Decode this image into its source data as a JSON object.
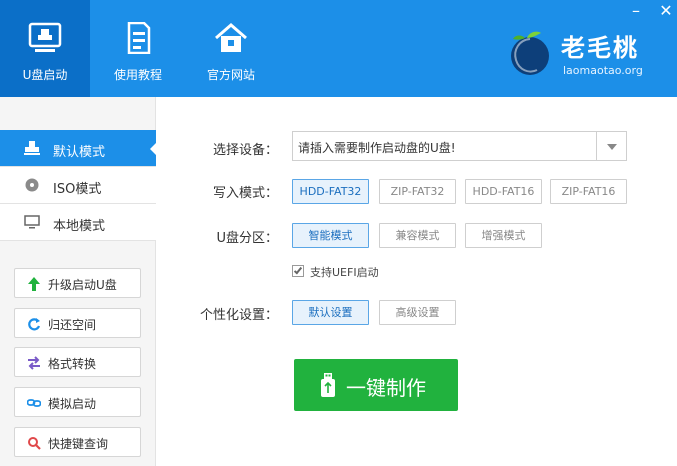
{
  "header": {
    "nav": [
      {
        "label": "U盘启动",
        "icon": "monitor-usb-icon"
      },
      {
        "label": "使用教程",
        "icon": "document-icon"
      },
      {
        "label": "官方网站",
        "icon": "home-icon"
      }
    ],
    "window_controls": {
      "minimize": "–",
      "close": "✕"
    },
    "logo": {
      "name": "老毛桃",
      "site": "laomaotao.org"
    }
  },
  "sidebar": {
    "modes": [
      {
        "label": "默认模式",
        "icon": "usb-drive-icon",
        "active": true
      },
      {
        "label": "ISO模式",
        "icon": "disc-icon",
        "active": false
      },
      {
        "label": "本地模式",
        "icon": "monitor-icon",
        "active": false
      }
    ],
    "tools": [
      {
        "label": "升级启动U盘",
        "icon": "arrow-up-icon"
      },
      {
        "label": "归还空间",
        "icon": "refresh-icon"
      },
      {
        "label": "格式转换",
        "icon": "swap-icon"
      },
      {
        "label": "模拟启动",
        "icon": "link-icon"
      },
      {
        "label": "快捷键查询",
        "icon": "search-icon"
      }
    ]
  },
  "main": {
    "device": {
      "label": "选择设备：",
      "value": "请插入需要制作启动盘的U盘!"
    },
    "write_mode": {
      "label": "写入模式：",
      "options": [
        "HDD-FAT32",
        "ZIP-FAT32",
        "HDD-FAT16",
        "ZIP-FAT16"
      ],
      "selected": "HDD-FAT32"
    },
    "partition": {
      "label": "U盘分区：",
      "options": [
        "智能模式",
        "兼容模式",
        "增强模式"
      ],
      "selected": "智能模式"
    },
    "uefi": {
      "label": "支持UEFI启动",
      "checked": true
    },
    "personalize": {
      "label": "个性化设置：",
      "options": [
        "默认设置",
        "高级设置"
      ],
      "selected": "默认设置"
    },
    "make_button": {
      "label": "一键制作"
    }
  },
  "colors": {
    "brand_blue": "#1c8fe8",
    "active_nav": "#0b6fc8",
    "action_green": "#21b23e"
  }
}
